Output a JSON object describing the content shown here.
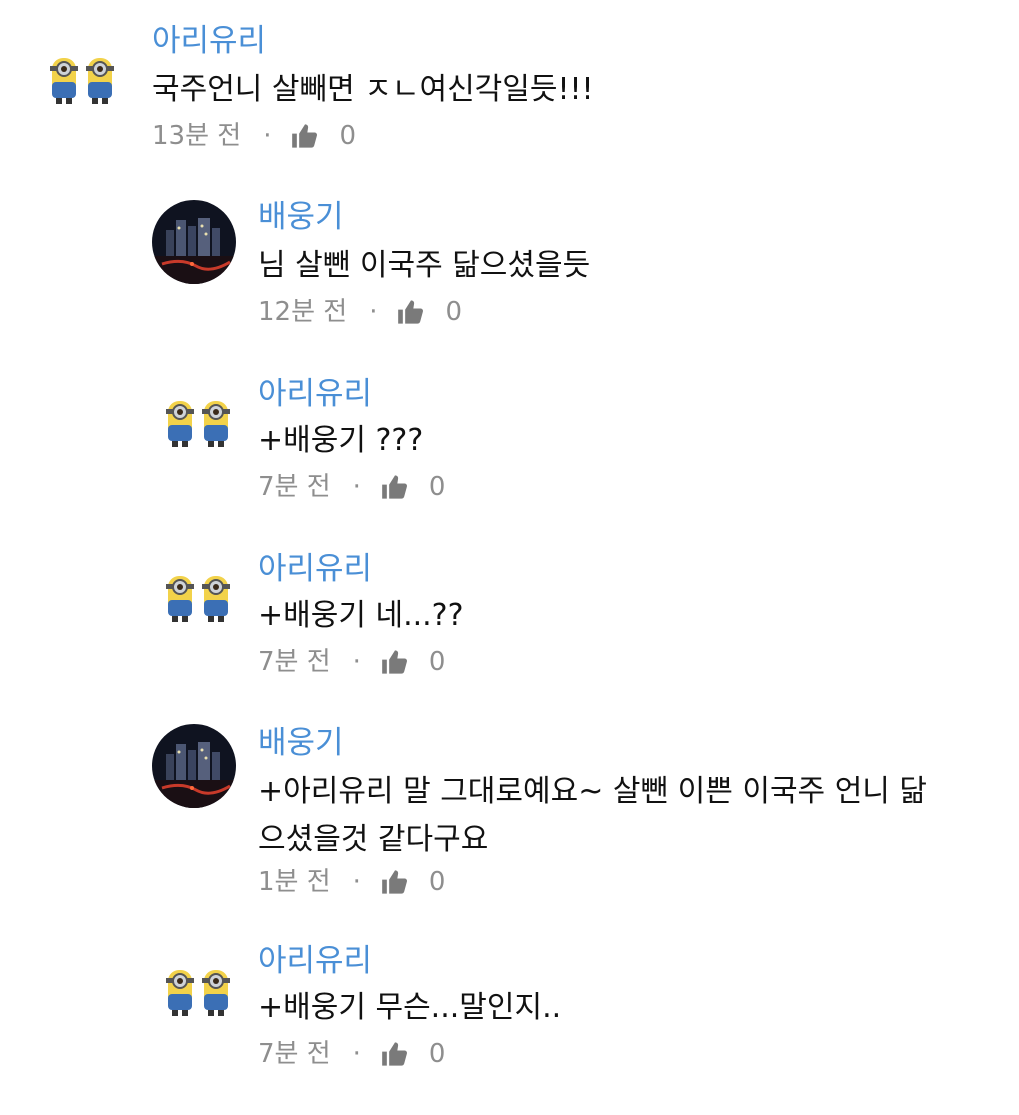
{
  "comments": [
    {
      "author": "아리유리",
      "avatar": "minion-avatar",
      "text": "국주언니 살빼면 ㅈㄴ여신각일듯!!!",
      "time": "13분 전",
      "likes": "0"
    },
    {
      "author": "배웅기",
      "avatar": "night-city-avatar",
      "text": "님 살뺀 이국주 닮으셨을듯",
      "time": "12분 전",
      "likes": "0"
    },
    {
      "author": "아리유리",
      "avatar": "minion-avatar",
      "text": "+배웅기 ???",
      "time": "7분 전",
      "likes": "0"
    },
    {
      "author": "아리유리",
      "avatar": "minion-avatar",
      "text": "+배웅기 네...??",
      "time": "7분 전",
      "likes": "0"
    },
    {
      "author": "배웅기",
      "avatar": "night-city-avatar",
      "text": "+아리유리 말 그대로예요~ 살뺀 이쁜 이국주 언니 닮\n으셨을것 같다구요",
      "time": "1분 전",
      "likes": "0"
    },
    {
      "author": "아리유리",
      "avatar": "minion-avatar",
      "text": "+배웅기 무슨...말인지..",
      "time": "7분 전",
      "likes": "0"
    }
  ],
  "icons": {
    "like": "thumbs-up-icon",
    "separator": "·"
  },
  "colors": {
    "author": "#4a8fd6",
    "text": "#111111",
    "meta": "#8e8e8e",
    "thumb": "#7a7a7a"
  }
}
